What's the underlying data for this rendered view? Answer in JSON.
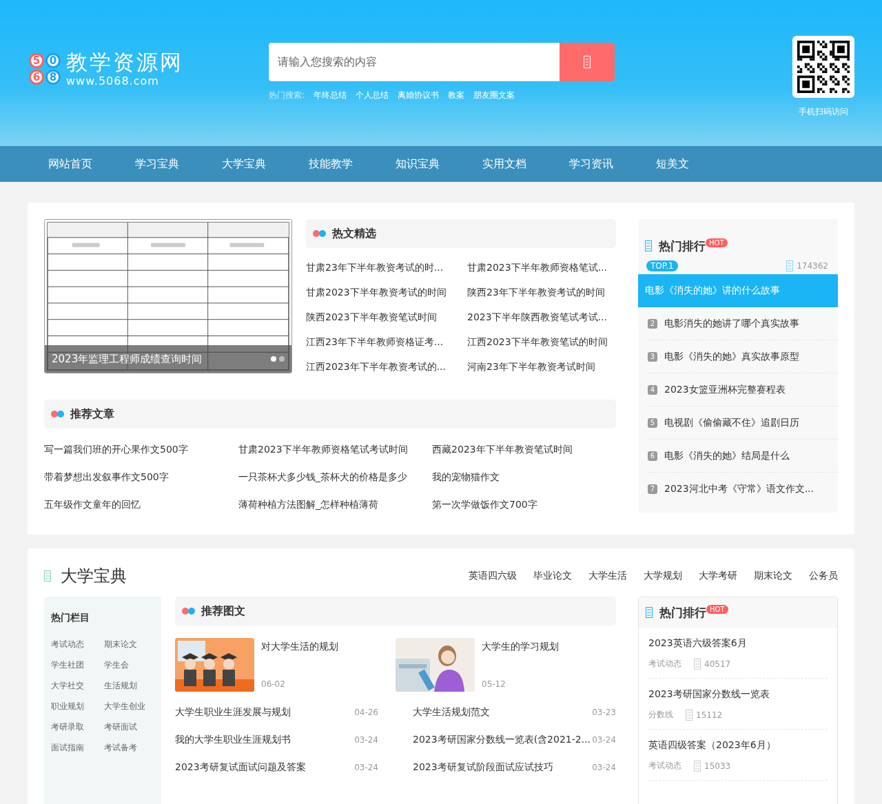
{
  "header": {
    "logo_digits": [
      "5",
      "0",
      "6",
      "8"
    ],
    "logo_title": "教学资源网",
    "logo_url": "www.5068.com",
    "search": {
      "placeholder": "请输入您搜索的内容"
    },
    "hot_search_label": "热门搜索:",
    "hot_searches": [
      "年终总结",
      "个人总结",
      "离婚协议书",
      "教案",
      "朋友圈文案"
    ],
    "qr_caption": "手机扫码访问"
  },
  "nav": [
    "网站首页",
    "学习宝典",
    "大学宝典",
    "技能教学",
    "知识宝典",
    "实用文档",
    "学习资讯",
    "短美文"
  ],
  "featured": {
    "slider": {
      "caption": "2023年监理工程师成绩查询时间",
      "dots": [
        {
          "selected": true
        },
        {
          "selected": false
        }
      ]
    },
    "hot_title": "热文精选",
    "hot_articles": [
      "甘肃23年下半年教资考试的时...",
      "甘肃2023下半年教师资格笔试...",
      "甘肃2023下半年教资考试的时间",
      "陕西23年下半年教资考试的时间",
      "陕西2023下半年教资笔试时间",
      "2023下半年陕西教资笔试考试...",
      "江西23年下半年教师资格证考...",
      "江西2023下半年教资笔试的时间",
      "江西2023年下半年教资考试的...",
      "河南23年下半年教资考试时间"
    ],
    "recommend_title": "推荐文章",
    "recommend_articles": [
      "写一篇我们班的开心果作文500字",
      "甘肃2023下半年教师资格笔试考试时间",
      "西藏2023年下半年教资笔试时间",
      "带着梦想出发叙事作文500字",
      "一只茶杯犬多少钱_茶杯犬的价格是多少",
      "我的宠物猫作文",
      "五年级作文童年的回忆",
      "薄荷种植方法图解_怎样种植薄荷",
      "第一次学做饭作文700字"
    ],
    "ranking": {
      "title": "热门排行",
      "badge": "HOT",
      "top_label": "TOP.1",
      "top_views": "174362",
      "items": [
        {
          "kind": "top",
          "title": "电影《消失的她》讲的什么故事"
        },
        {
          "kind": "item",
          "rank": "2",
          "title": "电影消失的她讲了哪个真实故事"
        },
        {
          "kind": "item",
          "rank": "3",
          "title": "电影《消失的她》真实故事原型"
        },
        {
          "kind": "item",
          "rank": "4",
          "title": "2023女篮亚洲杯完整赛程表"
        },
        {
          "kind": "item",
          "rank": "5",
          "title": "电视剧《偷偷藏不住》追剧日历"
        },
        {
          "kind": "item",
          "rank": "6",
          "title": "电影《消失的她》结局是什么"
        },
        {
          "kind": "item",
          "rank": "7",
          "title": "2023河北中考《守常》语文作文..."
        }
      ]
    }
  },
  "college": {
    "title": "大学宝典",
    "tags": [
      "英语四六级",
      "毕业论文",
      "大学生活",
      "大学规划",
      "大学考研",
      "期末论文",
      "公务员"
    ],
    "sidebar": {
      "title": "热门栏目",
      "links": [
        "考试动态",
        "期末论文",
        "学生社团",
        "学生会",
        "大学社交",
        "生活规划",
        "职业规划",
        "大学生创业",
        "考研录取",
        "考研面试",
        "面试指南",
        "考试备考"
      ]
    },
    "picks_title": "推荐图文",
    "picks": [
      {
        "kind": "graduates",
        "title": "对大学生活的规划",
        "date": "06-02"
      },
      {
        "kind": "reader",
        "title": "大学生的学习规划",
        "date": "05-12"
      }
    ],
    "list": [
      {
        "title": "大学生职业生涯发展与规划",
        "date": "04-26"
      },
      {
        "title": "大学生活规划范文",
        "date": "03-23"
      },
      {
        "title": "我的大学生职业生涯规划书",
        "date": "03-24"
      },
      {
        "title": "2023考研国家分数线一览表(含2021-2...",
        "date": "03-24"
      },
      {
        "title": "2023考研复试面试问题及答案",
        "date": "03-24"
      },
      {
        "title": "2023考研复试阶段面试应试技巧",
        "date": "03-24"
      }
    ],
    "ranking": {
      "title": "热门排行",
      "badge": "HOT",
      "items": [
        {
          "title": "2023英语六级答案6月",
          "category": "考试动态",
          "views": "40517"
        },
        {
          "title": "2023考研国家分数线一览表",
          "category": "分数线",
          "views": "15112"
        },
        {
          "title": "英语四级答案（2023年6月）",
          "category": "考试动态",
          "views": "15033"
        }
      ]
    }
  }
}
